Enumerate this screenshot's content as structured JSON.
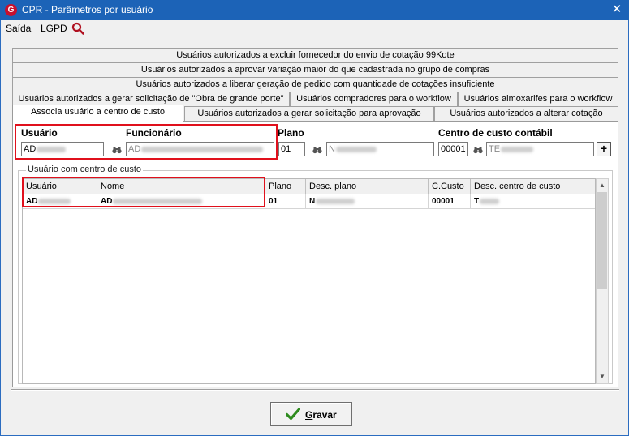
{
  "window": {
    "title": "CPR - Parâmetros por usuário",
    "close_glyph": "✕",
    "app_icon_glyph": "G"
  },
  "menu": {
    "items": [
      "Saída",
      "LGPD"
    ]
  },
  "tabs": {
    "row1": "Usuários autorizados a excluir fornecedor do envio de cotação 99Kote",
    "row2": "Usuários autorizados a aprovar variação maior do que cadastrada no grupo de compras",
    "row3": "Usuários autorizados a liberar geração de pedido com quantidade de cotações insuficiente",
    "row4": [
      "Usuários autorizados a gerar solicitação de \"Obra de grande porte\"",
      "Usuários compradores para o workflow",
      "Usuários almoxarifes para o workflow"
    ],
    "row5": [
      "Associa usuário a centro de custo",
      "Usuários autorizados a gerar solicitação para aprovação",
      "Usuários autorizados a alterar cotação"
    ]
  },
  "form": {
    "usuario_label": "Usuário",
    "usuario_value": "AD",
    "funcionario_label": "Funcionário",
    "funcionario_value": "AD",
    "plano_label": "Plano",
    "plano_value": "01",
    "plano_desc": "N",
    "cc_label": "Centro de custo contábil",
    "cc_value": "00001",
    "cc_desc": "TE",
    "add_glyph": "+"
  },
  "group": {
    "legend": "Usuário com centro de custo",
    "columns": [
      "Usuário",
      "Nome",
      "Plano",
      "Desc. plano",
      "C.Custo",
      "Desc. centro de custo"
    ],
    "rows": [
      [
        "AD",
        "AD",
        "01",
        "N",
        "00001",
        "T"
      ]
    ]
  },
  "buttons": {
    "gravar_label": "Gravar",
    "gravar_mnemonic": "G",
    "gravar_rest": "ravar"
  },
  "colors": {
    "titlebar": "#1c63b7",
    "highlight_box": "#e0101c",
    "app_icon": "#c8102e",
    "check": "#2e8b1e"
  },
  "icons": [
    "app-logo-icon",
    "close-icon",
    "search-icon",
    "binoculars-icon",
    "plus-icon",
    "check-icon",
    "scroll-up-icon",
    "scroll-down-icon"
  ]
}
